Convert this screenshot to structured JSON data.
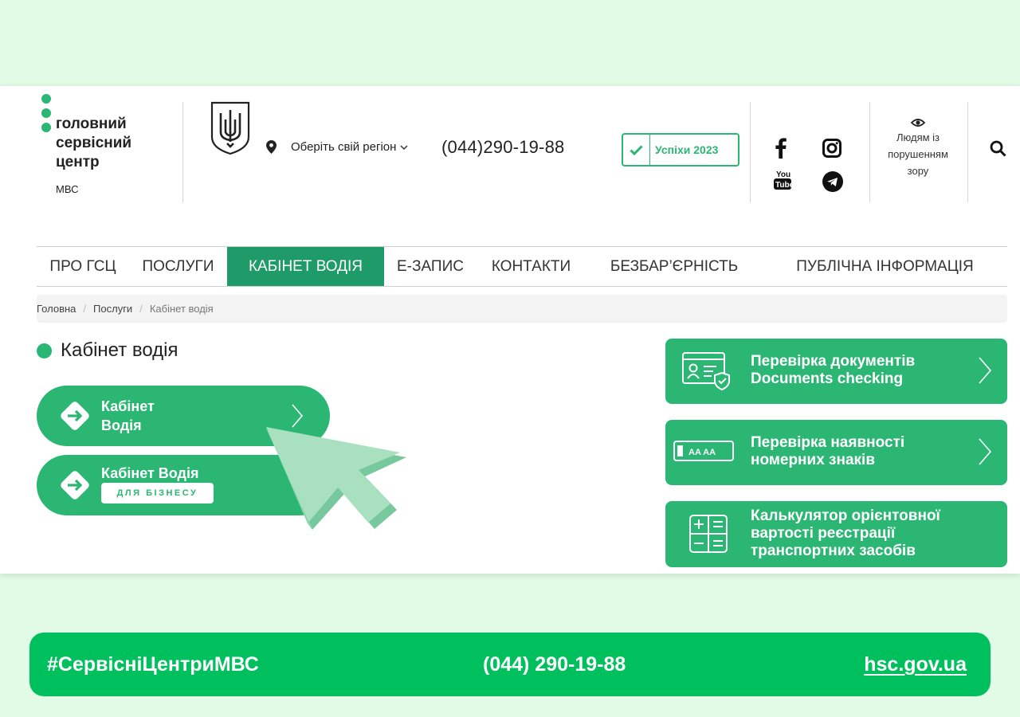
{
  "header": {
    "logo_lines": [
      "головний",
      "сервісний",
      "центр"
    ],
    "logo_sub": "МВС",
    "region_label": "Оберіть свій регіон",
    "phone": "(044)290-19-88",
    "success_label": "Успіхи 2023",
    "accessibility_lines": [
      "Людям із",
      "порушенням",
      "зору"
    ]
  },
  "nav": {
    "items": [
      {
        "label": "ПРО ГСЦ"
      },
      {
        "label": "ПОСЛУГИ"
      },
      {
        "label": "КАБІНЕТ ВОДІЯ"
      },
      {
        "label": "Е-ЗАПИС"
      },
      {
        "label": "КОНТАКТИ"
      },
      {
        "label": "БЕЗБАР’ЄРНІСТЬ"
      },
      {
        "label": "ПУБЛІЧНА ІНФОРМАЦІЯ"
      }
    ],
    "active": "КАБІНЕТ ВОДІЯ"
  },
  "breadcrumb": [
    "Головна",
    "Послуги",
    "Кабінет водія"
  ],
  "main": {
    "title": "Кабінет водія",
    "cabinet_button": {
      "line1": "Кабінет",
      "line2": "Водія"
    },
    "business_button": {
      "line1": "Кабінет Водія",
      "badge": "ДЛЯ БІЗНЕСУ"
    }
  },
  "cards": [
    {
      "lines": [
        "Перевірка документів",
        "Documents checking"
      ],
      "icon": "id-card-shield-icon"
    },
    {
      "lines": [
        "Перевірка наявності",
        "номерних знаків"
      ],
      "icon": "license-plate-icon",
      "plate_text": "AA  AA"
    },
    {
      "lines": [
        "Калькулятор орієнтовної",
        "вартості реєстрації",
        "транспортних засобів"
      ],
      "icon": "calculator-icon"
    }
  ],
  "banner": {
    "hashtag": "#СервісніЦентриМВС",
    "phone": "(044) 290-19-88",
    "url": "hsc.gov.ua"
  },
  "colors": {
    "brand_green": "#2bb673",
    "nav_active": "#1e9b68",
    "banner_green": "#00c05e",
    "background": "#e2fbe6"
  }
}
